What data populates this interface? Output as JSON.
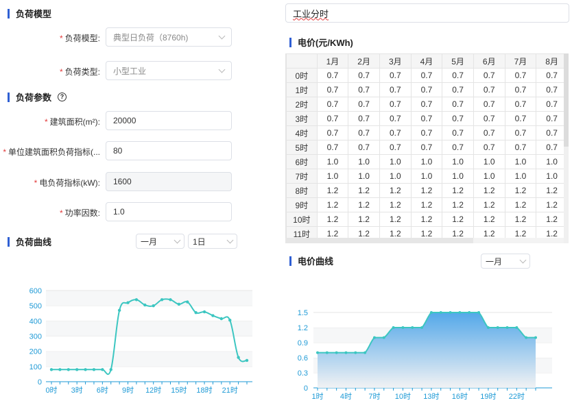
{
  "load_model_section": {
    "title": "负荷模型",
    "model_label": "负荷模型:",
    "model_value": "典型日负荷（8760h)",
    "type_label": "负荷类型:",
    "type_value": "小型工业"
  },
  "load_params_section": {
    "title": "负荷参数",
    "help_icon": "?",
    "fields": [
      {
        "label": "建筑面积(m²):",
        "value": "20000"
      },
      {
        "label": "单位建筑面积负荷指标(...",
        "value": "80"
      },
      {
        "label": "电负荷指标(kW):",
        "value": "1600"
      },
      {
        "label": "功率因数:",
        "value": "1.0"
      }
    ]
  },
  "load_curve_section": {
    "title": "负荷曲线",
    "month_select": "一月",
    "day_select": "1日"
  },
  "tariff_input": "工业分时",
  "price_section": {
    "title": "电价(元/KWh)",
    "months": [
      "1月",
      "2月",
      "3月",
      "4月",
      "5月",
      "6月",
      "7月",
      "8月"
    ],
    "rows": [
      {
        "hour": "0时",
        "values": [
          "0.7",
          "0.7",
          "0.7",
          "0.7",
          "0.7",
          "0.7",
          "0.7",
          "0.7"
        ]
      },
      {
        "hour": "1时",
        "values": [
          "0.7",
          "0.7",
          "0.7",
          "0.7",
          "0.7",
          "0.7",
          "0.7",
          "0.7"
        ]
      },
      {
        "hour": "2时",
        "values": [
          "0.7",
          "0.7",
          "0.7",
          "0.7",
          "0.7",
          "0.7",
          "0.7",
          "0.7"
        ]
      },
      {
        "hour": "3时",
        "values": [
          "0.7",
          "0.7",
          "0.7",
          "0.7",
          "0.7",
          "0.7",
          "0.7",
          "0.7"
        ]
      },
      {
        "hour": "4时",
        "values": [
          "0.7",
          "0.7",
          "0.7",
          "0.7",
          "0.7",
          "0.7",
          "0.7",
          "0.7"
        ]
      },
      {
        "hour": "5时",
        "values": [
          "0.7",
          "0.7",
          "0.7",
          "0.7",
          "0.7",
          "0.7",
          "0.7",
          "0.7"
        ]
      },
      {
        "hour": "6时",
        "values": [
          "1.0",
          "1.0",
          "1.0",
          "1.0",
          "1.0",
          "1.0",
          "1.0",
          "1.0"
        ]
      },
      {
        "hour": "7时",
        "values": [
          "1.0",
          "1.0",
          "1.0",
          "1.0",
          "1.0",
          "1.0",
          "1.0",
          "1.0"
        ]
      },
      {
        "hour": "8时",
        "values": [
          "1.2",
          "1.2",
          "1.2",
          "1.2",
          "1.2",
          "1.2",
          "1.2",
          "1.2"
        ]
      },
      {
        "hour": "9时",
        "values": [
          "1.2",
          "1.2",
          "1.2",
          "1.2",
          "1.2",
          "1.2",
          "1.2",
          "1.2"
        ]
      },
      {
        "hour": "10时",
        "values": [
          "1.2",
          "1.2",
          "1.2",
          "1.2",
          "1.2",
          "1.2",
          "1.2",
          "1.2"
        ]
      },
      {
        "hour": "11时",
        "values": [
          "1.2",
          "1.2",
          "1.2",
          "1.2",
          "1.2",
          "1.2",
          "1.2",
          "1.2"
        ]
      }
    ]
  },
  "price_curve_section": {
    "title": "电价曲线",
    "month_select": "一月"
  },
  "chart_data": [
    {
      "type": "line",
      "x": [
        "0时",
        "1时",
        "2时",
        "3时",
        "4时",
        "5时",
        "6时",
        "7时",
        "8时",
        "9时",
        "10时",
        "11时",
        "12时",
        "13时",
        "14时",
        "15时",
        "16时",
        "17时",
        "18时",
        "19时",
        "20时",
        "21时",
        "22时",
        "23时"
      ],
      "values": [
        80,
        80,
        80,
        80,
        80,
        80,
        80,
        80,
        470,
        520,
        540,
        505,
        500,
        540,
        540,
        510,
        525,
        455,
        460,
        435,
        415,
        405,
        160,
        140
      ],
      "xticks": [
        "0时",
        "3时",
        "6时",
        "9时",
        "12时",
        "15时",
        "18时",
        "21时"
      ],
      "yticks": [
        "0",
        "100",
        "200",
        "300",
        "400",
        "500",
        "600"
      ],
      "ylim": [
        0,
        600
      ],
      "color": "#3cc6c1",
      "grid": true
    },
    {
      "type": "area",
      "x": [
        "1时",
        "2时",
        "3时",
        "4时",
        "5时",
        "6时",
        "7时",
        "8时",
        "9时",
        "10时",
        "11时",
        "12时",
        "13时",
        "14时",
        "15时",
        "16时",
        "17时",
        "18时",
        "19时",
        "20时",
        "21时",
        "22时",
        "23时",
        "24时"
      ],
      "values": [
        0.7,
        0.7,
        0.7,
        0.7,
        0.7,
        0.7,
        1.0,
        1.0,
        1.2,
        1.2,
        1.2,
        1.2,
        1.5,
        1.5,
        1.5,
        1.5,
        1.5,
        1.5,
        1.2,
        1.2,
        1.2,
        1.2,
        1.0,
        1.0
      ],
      "xticks": [
        "1时",
        "4时",
        "7时",
        "10时",
        "13时",
        "16时",
        "19时",
        "22时"
      ],
      "yticks": [
        "0",
        "0.3",
        "0.6",
        "0.9",
        "1.2",
        "1.5"
      ],
      "ylim": [
        0,
        1.5
      ],
      "line_color": "#3cc6c1",
      "fill_top": "#4aa3e8",
      "fill_bottom": "#f0f1f3",
      "grid": true
    }
  ]
}
